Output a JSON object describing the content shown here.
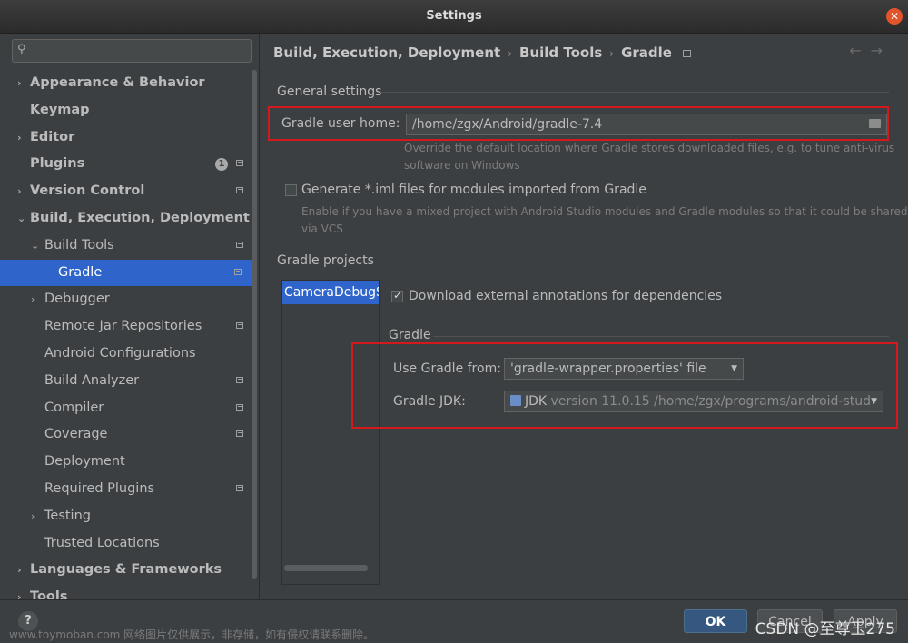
{
  "window": {
    "title": "Settings"
  },
  "sidebar": {
    "search_placeholder": "",
    "items": [
      {
        "label": "Appearance & Behavior",
        "arrow": "›",
        "bold": true
      },
      {
        "label": "Keymap",
        "bold": true
      },
      {
        "label": "Editor",
        "arrow": "›",
        "bold": true
      },
      {
        "label": "Plugins",
        "bold": true,
        "badge": "1"
      },
      {
        "label": "Version Control",
        "arrow": "›",
        "bold": true
      },
      {
        "label": "Build, Execution, Deployment",
        "arrow": "⌄",
        "bold": true
      },
      {
        "label": "Build Tools",
        "arrow": "⌄"
      },
      {
        "label": "Gradle",
        "selected": true
      },
      {
        "label": "Debugger",
        "arrow": "›"
      },
      {
        "label": "Remote Jar Repositories"
      },
      {
        "label": "Android Configurations"
      },
      {
        "label": "Build Analyzer"
      },
      {
        "label": "Compiler"
      },
      {
        "label": "Coverage"
      },
      {
        "label": "Deployment"
      },
      {
        "label": "Required Plugins"
      },
      {
        "label": "Testing",
        "arrow": "›"
      },
      {
        "label": "Trusted Locations"
      },
      {
        "label": "Languages & Frameworks",
        "arrow": "›",
        "bold": true
      },
      {
        "label": "Tools",
        "arrow": "›",
        "bold": true
      }
    ]
  },
  "breadcrumb": {
    "items": [
      "Build, Execution, Deployment",
      "Build Tools",
      "Gradle"
    ],
    "separator": "›",
    "nav_back": "←",
    "nav_forward": "→"
  },
  "general": {
    "title": "General settings",
    "user_home_label": "Gradle user home:",
    "user_home_value": "/home/zgx/Android/gradle-7.4",
    "user_home_hint_1": "Override the default location where Gradle stores downloaded files, e.g. to tune anti-virus",
    "user_home_hint_2": "software on Windows",
    "iml_label": "Generate *.iml files for modules imported from Gradle",
    "iml_checked": false,
    "iml_hint_1": "Enable if you have a mixed project with Android Studio modules and Gradle modules so that it could be shared",
    "iml_hint_2": "via VCS"
  },
  "projects": {
    "title": "Gradle projects",
    "list": [
      "CameraDebugSe"
    ],
    "download_label": "Download external annotations for dependencies",
    "download_checked": true,
    "gradle_section": "Gradle",
    "use_from_label": "Use Gradle from:",
    "use_from_value": "'gradle-wrapper.properties' file",
    "jdk_label": "Gradle JDK:",
    "jdk_name": "JDK",
    "jdk_detail": "version 11.0.15 /home/zgx/programs/android-stud"
  },
  "footer": {
    "help": "?",
    "ok": "OK",
    "cancel": "Cancel",
    "apply": "Apply",
    "watermark": "www.toymoban.com 网络图片仅供展示，非存储，如有侵权请联系删除。",
    "watermark2": "CSDN @至尊玉275"
  },
  "colors": {
    "selection": "#2f65ca",
    "highlight_box": "#d3191c",
    "ok_button": "#365880"
  }
}
